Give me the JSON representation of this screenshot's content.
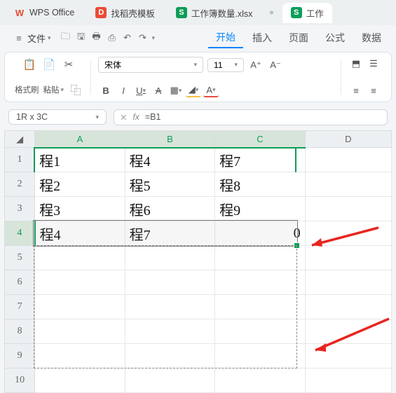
{
  "tabs": {
    "wps": "WPS Office",
    "docer": "找稻壳模板",
    "file1": "工作簿数量.xlsx",
    "file2": "工作"
  },
  "menu": {
    "file": "文件",
    "start": "开始",
    "insert": "插入",
    "page": "页面",
    "formula": "公式",
    "data": "数据"
  },
  "ribbon": {
    "format_painter": "格式刷",
    "paste": "粘贴",
    "font_name": "宋体",
    "font_size": "11"
  },
  "formula_bar": {
    "name_box": "1R x 3C",
    "formula": "=B1"
  },
  "columns": [
    "A",
    "B",
    "C",
    "D"
  ],
  "rows": [
    "1",
    "2",
    "3",
    "4",
    "5",
    "6",
    "7",
    "8",
    "9",
    "10"
  ],
  "cells": {
    "A1": "程1",
    "B1": "程4",
    "C1": "程7",
    "A2": "程2",
    "B2": "程5",
    "C2": "程8",
    "A3": "程3",
    "B3": "程6",
    "C3": "程9",
    "A4": "程4",
    "B4": "程7",
    "C4": "0"
  },
  "chart_data": {
    "type": "table",
    "title": "",
    "columns": [
      "A",
      "B",
      "C"
    ],
    "rows": [
      [
        "程1",
        "程4",
        "程7"
      ],
      [
        "程2",
        "程5",
        "程8"
      ],
      [
        "程3",
        "程6",
        "程9"
      ],
      [
        "程4",
        "程7",
        0
      ]
    ]
  }
}
